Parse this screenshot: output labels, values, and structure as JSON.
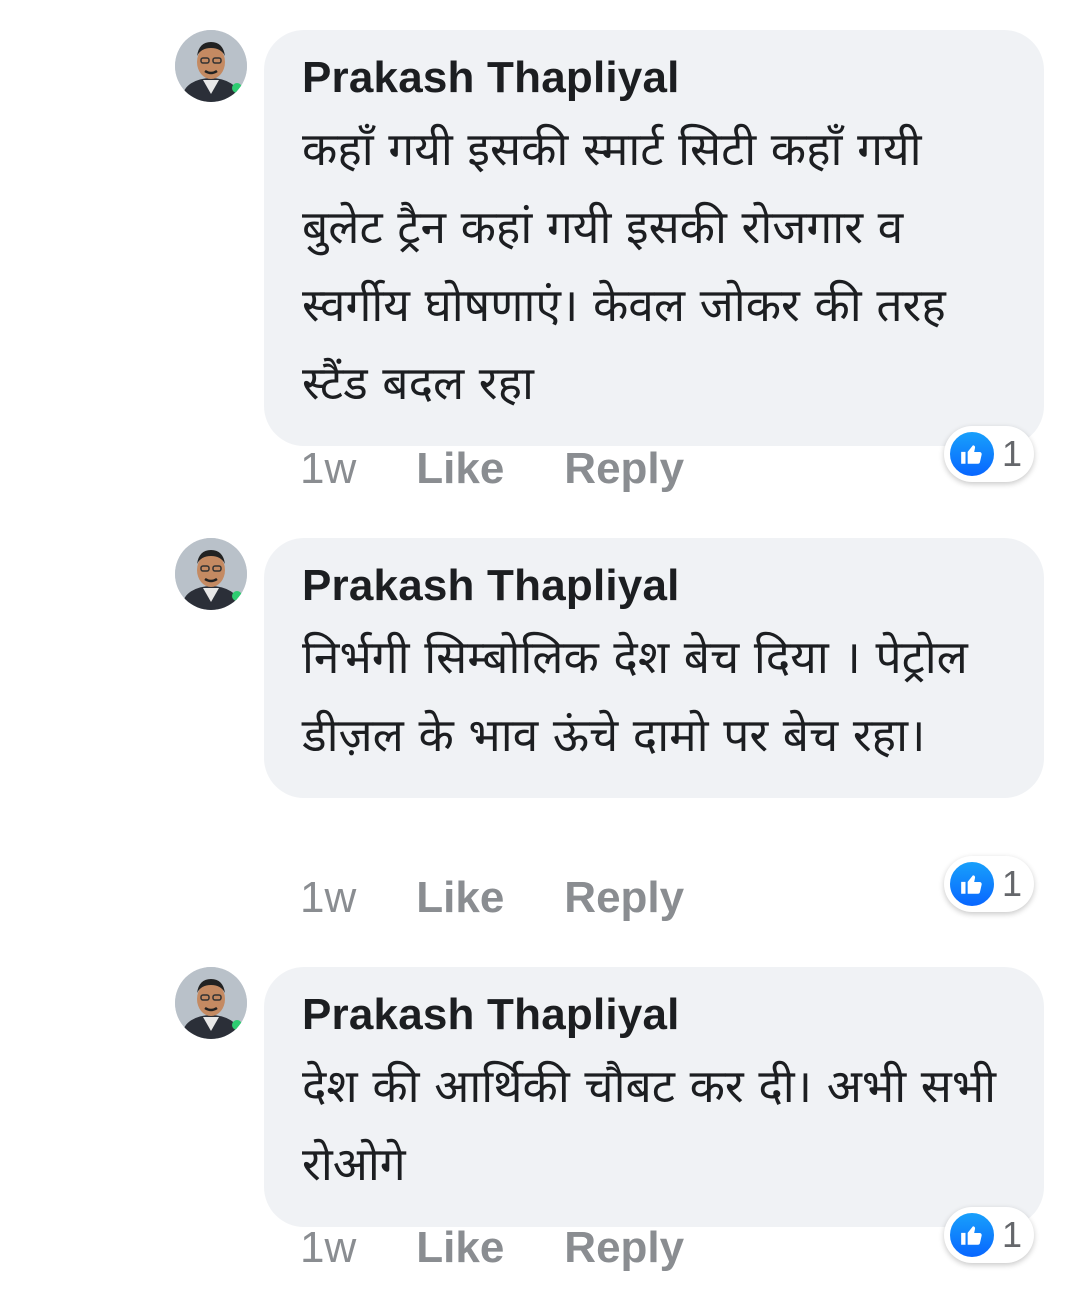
{
  "comments": [
    {
      "author": "Prakash Thapliyal",
      "text": "कहाँ गयी इसकी स्मार्ट सिटी कहाँ गयी बुलेट ट्रैन कहां गयी इसकी रोजगार व स्वर्गीय घोषणाएं। केवल जोकर की तरह स्टैंड बदल रहा",
      "time": "1w",
      "like_label": "Like",
      "reply_label": "Reply",
      "reaction_count": "1",
      "reaction_icon": "thumbs-up-icon"
    },
    {
      "author": "Prakash Thapliyal",
      "text": "निर्भगी सिम्बोलिक देश बेच दिया । पेट्रोल डीज़ल के भाव ऊंचे दामो पर बेच रहा।",
      "time": "1w",
      "like_label": "Like",
      "reply_label": "Reply",
      "reaction_count": "1",
      "reaction_icon": "thumbs-up-icon"
    },
    {
      "author": "Prakash Thapliyal",
      "text": "देश की आर्थिकी चौबट कर दी। अभी सभी रोओगे",
      "time": "1w",
      "like_label": "Like",
      "reply_label": "Reply",
      "reaction_count": "1",
      "reaction_icon": "thumbs-up-icon"
    }
  ],
  "colors": {
    "bubble_bg": "#f0f2f5",
    "text": "#1c1e21",
    "meta": "#8a8d91",
    "like_blue": "#0866ff"
  }
}
